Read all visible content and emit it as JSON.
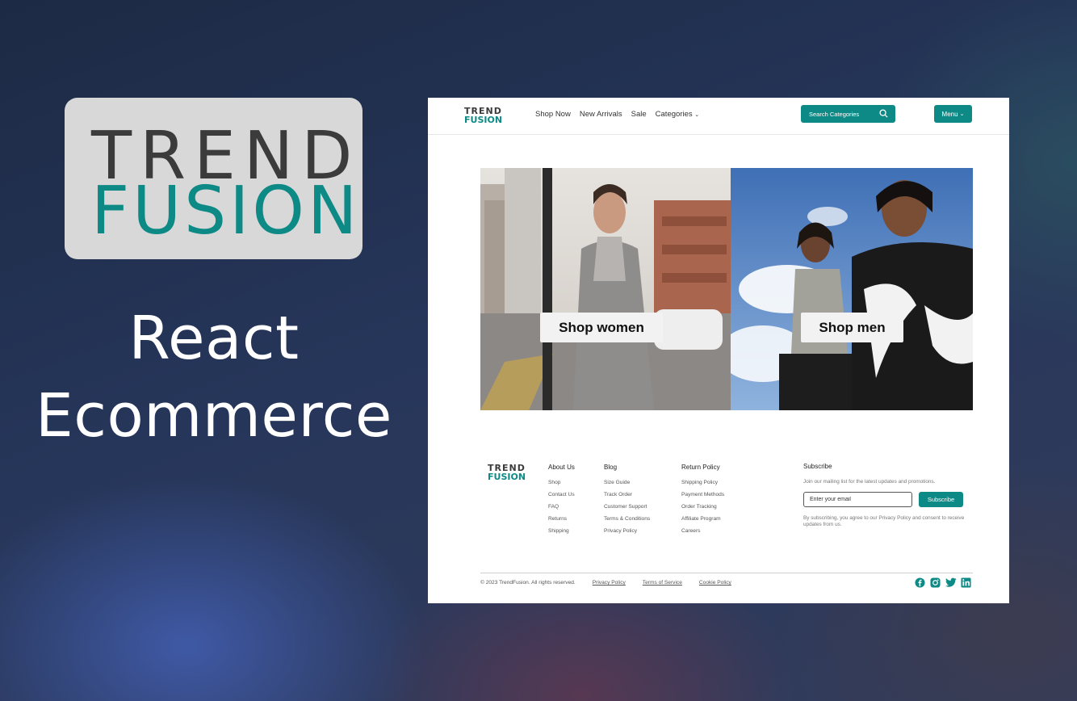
{
  "promo": {
    "logo_top": "TREND",
    "logo_bottom": "FUSION",
    "title_line1": "React",
    "title_line2": "Ecommerce"
  },
  "header": {
    "logo_top": "TREND",
    "logo_bottom": "FUSION",
    "nav": [
      "Shop Now",
      "New Arrivals",
      "Sale",
      "Categories"
    ],
    "search_label": "Search Categories",
    "menu_label": "Menu"
  },
  "hero": {
    "women_label": "Shop women",
    "men_label": "Shop men"
  },
  "footer": {
    "columns": [
      {
        "title": "About Us",
        "links": [
          "Shop",
          "Contact Us",
          "FAQ",
          "Returns",
          "Shipping"
        ]
      },
      {
        "title": "Blog",
        "links": [
          "Size Guide",
          "Track Order",
          "Customer Support",
          "Terms & Conditions",
          "Privacy Policy"
        ]
      },
      {
        "title": "Return Policy",
        "links": [
          "Shipping Policy",
          "Payment Methods",
          "Order Tracking",
          "Affiliate Program",
          "Careers"
        ]
      }
    ],
    "subscribe": {
      "title": "Subscribe",
      "text": "Join our mailing list for the latest updates and promotions.",
      "placeholder": "Enter your email",
      "button": "Subscribe",
      "note": "By subscribing, you agree to our Privacy Policy and consent to receive updates from us."
    },
    "copyright": "© 2023 TrendFusion. All rights reserved.",
    "legal": [
      "Privacy Policy",
      "Terms of Service",
      "Cookie Policy"
    ],
    "socials": [
      "facebook-icon",
      "instagram-icon",
      "twitter-icon",
      "linkedin-icon"
    ]
  },
  "colors": {
    "accent": "#0d8a86",
    "logo_dark": "#3b3b3b"
  }
}
